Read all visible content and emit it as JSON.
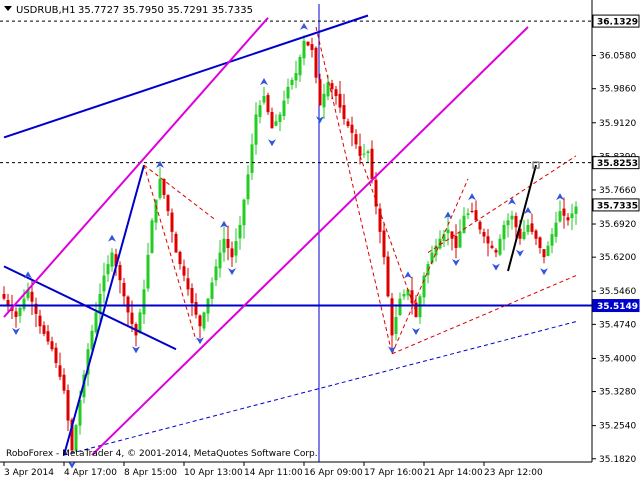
{
  "header": {
    "symbol": "USDRUB,H1",
    "ohlc": "35.7727 35.7950 35.7291 35.7335"
  },
  "copyright": "RoboForex - MetaTrader 4, © 2001-2014, MetaQuotes Software Corp.",
  "colors": {
    "bull": "#22cc22",
    "bear": "#dd0000",
    "support": "#0000cc",
    "channel": "#dd00dd",
    "level": "#000000",
    "target": "#dd0000"
  },
  "chart_data": {
    "type": "candlestick",
    "symbol": "USDRUB",
    "timeframe": "H1",
    "ylim": [
      35.175,
      36.17
    ],
    "y_ticks": [
      36.058,
      35.986,
      35.912,
      35.839,
      35.766,
      35.692,
      35.62,
      35.546,
      35.474,
      35.4,
      35.328,
      35.254,
      35.182
    ],
    "x_ticks": [
      "3 Apr 2014",
      "4 Apr 17:00",
      "8 Apr 15:00",
      "10 Apr 13:00",
      "14 Apr 11:00",
      "16 Apr 09:00",
      "17 Apr 16:00",
      "21 Apr 14:00",
      "23 Apr 12:00"
    ],
    "price_tags": [
      {
        "label": "36.1329",
        "value": 36.1329,
        "style": "level"
      },
      {
        "label": "35.8253",
        "value": 35.8253,
        "style": "level"
      },
      {
        "label": "35.7335",
        "value": 35.7335,
        "style": "current"
      },
      {
        "label": "35.5149",
        "value": 35.5149,
        "style": "support"
      }
    ],
    "horizontal_lines": [
      {
        "value": 36.1329,
        "style": "dashed-black"
      },
      {
        "value": 35.8253,
        "style": "dashed-black"
      },
      {
        "value": 35.5149,
        "style": "solid-blue"
      }
    ],
    "close_path": [
      [
        0,
        35.53
      ],
      [
        3,
        35.49
      ],
      [
        6,
        35.55
      ],
      [
        9,
        35.47
      ],
      [
        12,
        35.42
      ],
      [
        15,
        35.33
      ],
      [
        17,
        35.2
      ],
      [
        19,
        35.31
      ],
      [
        21,
        35.42
      ],
      [
        23,
        35.5
      ],
      [
        25,
        35.58
      ],
      [
        27,
        35.63
      ],
      [
        29,
        35.57
      ],
      [
        31,
        35.5
      ],
      [
        33,
        35.45
      ],
      [
        35,
        35.55
      ],
      [
        37,
        35.7
      ],
      [
        39,
        35.79
      ],
      [
        41,
        35.72
      ],
      [
        43,
        35.63
      ],
      [
        45,
        35.58
      ],
      [
        47,
        35.52
      ],
      [
        49,
        35.47
      ],
      [
        51,
        35.53
      ],
      [
        53,
        35.6
      ],
      [
        55,
        35.66
      ],
      [
        57,
        35.62
      ],
      [
        59,
        35.69
      ],
      [
        61,
        35.8
      ],
      [
        63,
        35.93
      ],
      [
        65,
        35.97
      ],
      [
        67,
        35.9
      ],
      [
        69,
        35.93
      ],
      [
        71,
        35.99
      ],
      [
        73,
        36.02
      ],
      [
        75,
        36.09
      ],
      [
        77,
        36.07
      ],
      [
        79,
        35.95
      ],
      [
        81,
        36.0
      ],
      [
        83,
        35.97
      ],
      [
        85,
        35.92
      ],
      [
        87,
        35.89
      ],
      [
        89,
        35.84
      ],
      [
        91,
        35.85
      ],
      [
        93,
        35.73
      ],
      [
        95,
        35.62
      ],
      [
        97,
        35.45
      ],
      [
        99,
        35.53
      ],
      [
        101,
        35.55
      ],
      [
        103,
        35.49
      ],
      [
        105,
        35.58
      ],
      [
        107,
        35.63
      ],
      [
        109,
        35.66
      ],
      [
        111,
        35.68
      ],
      [
        113,
        35.64
      ],
      [
        115,
        35.71
      ],
      [
        117,
        35.72
      ],
      [
        119,
        35.68
      ],
      [
        121,
        35.65
      ],
      [
        123,
        35.63
      ],
      [
        125,
        35.69
      ],
      [
        127,
        35.71
      ],
      [
        129,
        35.66
      ],
      [
        131,
        35.69
      ],
      [
        133,
        35.66
      ],
      [
        135,
        35.62
      ],
      [
        137,
        35.67
      ],
      [
        139,
        35.72
      ],
      [
        141,
        35.7
      ],
      [
        143,
        35.73
      ]
    ],
    "trendlines": [
      {
        "points": [
          [
            0,
            35.6
          ],
          [
            43,
            35.42
          ]
        ],
        "color": "support",
        "dash": false
      },
      {
        "points": [
          [
            0,
            35.88
          ],
          [
            91,
            36.145
          ]
        ],
        "color": "support",
        "dash": false
      },
      {
        "points": [
          [
            15,
            35.19
          ],
          [
            35,
            35.82
          ]
        ],
        "color": "support",
        "dash": false
      },
      {
        "points": [
          [
            15,
            35.19
          ],
          [
            143,
            35.48
          ]
        ],
        "color": "support",
        "dash": true
      },
      {
        "points": [
          [
            0,
            35.49
          ],
          [
            66,
            36.14
          ]
        ],
        "color": "channel",
        "dash": false
      },
      {
        "points": [
          [
            22,
            35.19
          ],
          [
            131,
            36.12
          ]
        ],
        "color": "channel",
        "dash": false
      },
      {
        "points": [
          [
            35,
            35.82
          ],
          [
            53,
            35.7
          ]
        ],
        "color": "target",
        "dash": true
      },
      {
        "points": [
          [
            35,
            35.82
          ],
          [
            48,
            35.44
          ]
        ],
        "color": "target",
        "dash": true
      },
      {
        "points": [
          [
            78,
            36.12
          ],
          [
            97,
            35.41
          ]
        ],
        "color": "target",
        "dash": true
      },
      {
        "points": [
          [
            89,
            35.84
          ],
          [
            103,
            35.5
          ]
        ],
        "color": "target",
        "dash": true
      },
      {
        "points": [
          [
            97,
            35.41
          ],
          [
            143,
            35.58
          ]
        ],
        "color": "target",
        "dash": true
      },
      {
        "points": [
          [
            106,
            35.63
          ],
          [
            143,
            35.84
          ]
        ],
        "color": "target",
        "dash": true
      },
      {
        "points": [
          [
            97,
            35.41
          ],
          [
            116,
            35.79
          ]
        ],
        "color": "target",
        "dash": true
      },
      {
        "points": [
          [
            126,
            35.59
          ],
          [
            133,
            35.82
          ]
        ],
        "color": "level",
        "dash": false
      }
    ]
  }
}
